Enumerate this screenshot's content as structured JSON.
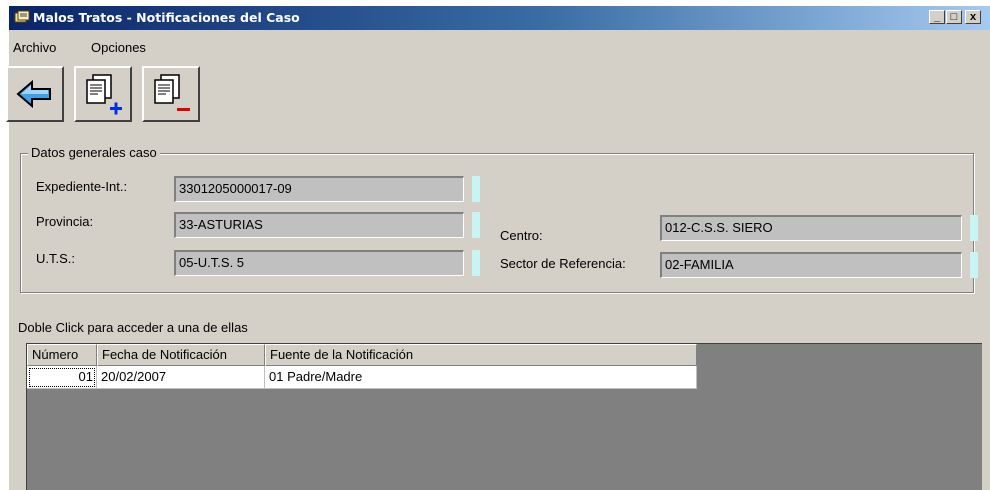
{
  "window": {
    "title": "Malos Tratos - Notificaciones del Caso",
    "controls": {
      "minimize": "_",
      "maximize": "□",
      "close": "x"
    }
  },
  "menu": {
    "items": [
      "Archivo",
      "Opciones"
    ]
  },
  "toolbar": {
    "buttons": [
      {
        "name": "back",
        "icon": "back-arrow-icon"
      },
      {
        "name": "add-notification",
        "icon": "document-plus-icon"
      },
      {
        "name": "remove-notification",
        "icon": "document-minus-icon"
      }
    ]
  },
  "datos": {
    "legend": "Datos generales caso",
    "expediente_label": "Expediente-Int.:",
    "expediente_value": "3301205000017-09",
    "provincia_label": "Provincia:",
    "provincia_value": "33-ASTURIAS",
    "uts_label": "U.T.S.:",
    "uts_value": "05-U.T.S. 5",
    "centro_label": "Centro:",
    "centro_value": "012-C.S.S. SIERO",
    "sector_label": "Sector de Referencia:",
    "sector_value": "02-FAMILIA"
  },
  "hint": "Doble Click para acceder a una de ellas",
  "grid": {
    "columns": [
      "Número",
      "Fecha de Notificación",
      "Fuente de la Notificación"
    ],
    "rows": [
      [
        "01",
        "20/02/2007",
        "01 Padre/Madre"
      ]
    ]
  },
  "colors": {
    "title_start": "#0a246a",
    "title_end": "#a6caf0",
    "window_bg": "#d4d0c8",
    "field_bg": "#c0c0c0",
    "marker": "#c8f4f4",
    "grid_bg": "#808080"
  }
}
